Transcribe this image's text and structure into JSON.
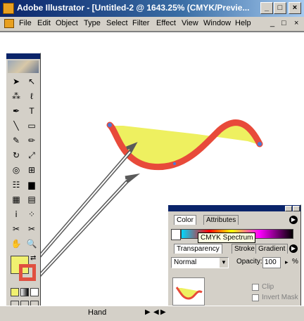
{
  "titlebar": {
    "title": "Adobe Illustrator - [Untitled-2 @ 1643.25% (CMYK/Previe...",
    "minimize": "_",
    "maximize": "□",
    "close": "×"
  },
  "menu": {
    "items": [
      "File",
      "Edit",
      "Object",
      "Type",
      "Select",
      "Filter",
      "Effect",
      "View",
      "Window",
      "Help"
    ],
    "mdi_min": "_",
    "mdi_max": "□",
    "mdi_close": "×"
  },
  "toolbox": {
    "tools": [
      {
        "icon": "selection-arrow-icon",
        "glyph": "➤"
      },
      {
        "icon": "direct-selection-icon",
        "glyph": "↖"
      },
      {
        "icon": "magic-wand-icon",
        "glyph": "⁂"
      },
      {
        "icon": "lasso-icon",
        "glyph": "ℓ"
      },
      {
        "icon": "pen-icon",
        "glyph": "✒"
      },
      {
        "icon": "type-icon",
        "glyph": "T"
      },
      {
        "icon": "line-segment-icon",
        "glyph": "╲"
      },
      {
        "icon": "rectangle-icon",
        "glyph": "▭"
      },
      {
        "icon": "paintbrush-icon",
        "glyph": "✎"
      },
      {
        "icon": "pencil-icon",
        "glyph": "✏"
      },
      {
        "icon": "rotate-icon",
        "glyph": "↻"
      },
      {
        "icon": "scale-icon",
        "glyph": "⤢"
      },
      {
        "icon": "warp-icon",
        "glyph": "◎"
      },
      {
        "icon": "free-transform-icon",
        "glyph": "⊞"
      },
      {
        "icon": "symbol-sprayer-icon",
        "glyph": "☷"
      },
      {
        "icon": "column-graph-icon",
        "glyph": "▆"
      },
      {
        "icon": "mesh-icon",
        "glyph": "▦"
      },
      {
        "icon": "gradient-icon",
        "glyph": "▤"
      },
      {
        "icon": "eyedropper-icon",
        "glyph": "ⅰ"
      },
      {
        "icon": "blend-icon",
        "glyph": "⁘"
      },
      {
        "icon": "scissors-icon",
        "glyph": "✂"
      },
      {
        "icon": "knife-icon",
        "glyph": "✂"
      },
      {
        "icon": "hand-icon",
        "glyph": "✋"
      },
      {
        "icon": "zoom-icon",
        "glyph": "🔍"
      }
    ]
  },
  "fill_color": "#f0f070",
  "stroke_color": "#e05040",
  "statusbar": {
    "tool_name": "Hand",
    "left_arrow": "◀",
    "right_arrow": "▶"
  },
  "color_panel": {
    "tabs": [
      "Color",
      "Attributes"
    ],
    "tooltip": "CMYK Spectrum"
  },
  "transparency_panel": {
    "tabs": [
      "Transparency",
      "Stroke",
      "Gradient"
    ],
    "blend_mode": "Normal",
    "opacity_label": "Opacity:",
    "opacity_value": "100",
    "opacity_unit": "%",
    "clip_label": "Clip",
    "invert_mask_label": "Invert Mask"
  }
}
